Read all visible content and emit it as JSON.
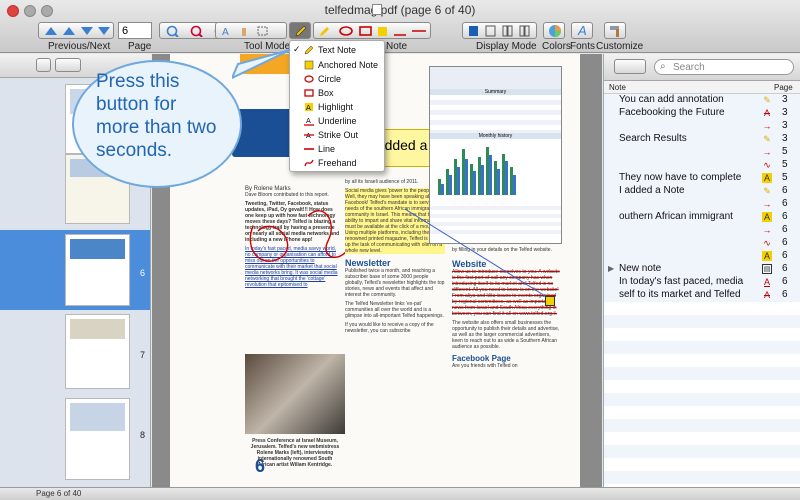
{
  "window": {
    "title": "telfedmag.pdf (page 6 of 40)"
  },
  "toolbar": {
    "page_number": "6",
    "labels": {
      "prev_next": "Previous/Next",
      "page": "Page",
      "tool_mode": "Tool Mode",
      "note": "Note",
      "display_mode": "Display Mode",
      "colors": "Colors",
      "fonts": "Fonts",
      "customize": "Customize"
    }
  },
  "callout": {
    "text": "Press this button for more than two seconds."
  },
  "tool_menu": {
    "items": [
      {
        "label": "Text Note",
        "checked": true,
        "icon": "text-note-icon"
      },
      {
        "label": "Anchored Note",
        "checked": false,
        "icon": "anchored-note-icon"
      },
      {
        "label": "Circle",
        "checked": false,
        "icon": "circle-icon"
      },
      {
        "label": "Box",
        "checked": false,
        "icon": "box-icon"
      },
      {
        "label": "Highlight",
        "checked": false,
        "icon": "highlight-icon"
      },
      {
        "label": "Underline",
        "checked": false,
        "icon": "underline-icon"
      },
      {
        "label": "Strike Out",
        "checked": false,
        "icon": "strike-out-icon"
      },
      {
        "label": "Line",
        "checked": false,
        "icon": "line-icon"
      },
      {
        "label": "Freehand",
        "checked": false,
        "icon": "freehand-icon"
      }
    ]
  },
  "thumbnails": [
    {
      "number": ""
    },
    {
      "number": ""
    },
    {
      "number": "6"
    },
    {
      "number": "7"
    },
    {
      "number": "8"
    }
  ],
  "page": {
    "note_box_text": "I added a Note",
    "byline": "By Rolene Marks",
    "byline2": "Dave Bloom contributed to this report.",
    "col1_lead": "Tweeting, Twitter, Facebook, status updates, iPad, Oy gevalt!!! How does one keep up with how fast technology moves these days? Telfed is blazing a technology trail by having a presence on nearly all social media networks and including a new iPhone app!",
    "col1_p2": "In today's fast paced, media savvy world, no company or organisation can afford to miss out on the opportunities to communicate with their market that social media networks bring. It was social media networking that brought the 'cottage' revolution that epitomised to",
    "col2_top": "by all its Israeli audience of 2011.",
    "col2_p1": "Social media gives 'power to the people'. Well, they may have been speaking about Facebook! Telfed's mandate is to service the needs of the southern African immigrant community in Israel. This means that the ability to impart and share vital information must be available at the click of a mouse. Using multiple platforms, including the renowned printed magazine, Telfed is taking up the task of communicating with olim on a whole new level.",
    "newsletter_head": "Newsletter",
    "col2_p2": "Published twice a month, and reaching a subscriber base of some 3000 people globally, Telfed's newsletter highlights the top stories, news and events that affect and interest the community.",
    "col2_p3": "The Telfed Newsletter links 'ex-pat' communities all over the world and is a glimpse into all-important Telfed happenings.",
    "col2_p4": "If you would like to receive a copy of the newsletter, you can subscribe",
    "col3_top": "by filling in your details on the Telfed website.",
    "website_head": "Website",
    "col3_p1": "Allow us to introduce ourselves to you. A website is the first port-of-call any company has when introducing itself to its market and Telfed is no different. All you need to know is on the website! From aliya and klita issues to events organised by regional committees, as well as important news from Israel and South Africa everything in between, you can find it all on www.telfed.org.il.",
    "col3_p2": "The website also offers small businesses the opportunity to publish their details and advertise, as well as the larger commercial advertisers, keen to reach out to as wide a Southern African audience as possible.",
    "facebook_head": "Facebook Page",
    "col3_p3": "Are you friends with Telfed on",
    "photo_caption": "Press Conference at Israel Museum, Jerusalem. Telfed's new webmistress Rolene Marks (left), interviewing internationally renowned South African artist Wiliam Kentridge.",
    "page_number": "6",
    "dash_title": "Summary",
    "dash_subtitle": "Monthly history"
  },
  "notes_panel": {
    "search_placeholder": "Search",
    "col_note": "Note",
    "col_page": "Page",
    "rows": [
      {
        "text": "You can add annotation",
        "page": "3",
        "icon": "pencil-icon",
        "color": "#d9b000"
      },
      {
        "text": "Facebooking the Future",
        "page": "3",
        "icon": "strike-icon",
        "color": "#c00000"
      },
      {
        "text": "",
        "page": "3",
        "icon": "arrow-icon",
        "color": "#c00000"
      },
      {
        "text": "Search Results",
        "page": "3",
        "icon": "pencil-icon",
        "color": "#d9b000"
      },
      {
        "text": "",
        "page": "5",
        "icon": "arrow-icon",
        "color": "#c00000"
      },
      {
        "text": "",
        "page": "5",
        "icon": "freehand-icon",
        "color": "#c00000"
      },
      {
        "text": "They now have to complete",
        "page": "5",
        "icon": "highlight-icon",
        "color": "#d9b000"
      },
      {
        "text": "I added a Note",
        "page": "6",
        "icon": "pencil-icon",
        "color": "#d9b000"
      },
      {
        "text": "",
        "page": "6",
        "icon": "arrow-icon",
        "color": "#c00000"
      },
      {
        "text": "outhern African immigrant",
        "page": "6",
        "icon": "highlight-icon",
        "color": "#d9b000"
      },
      {
        "text": "",
        "page": "6",
        "icon": "arrow-icon",
        "color": "#c00000"
      },
      {
        "text": "",
        "page": "6",
        "icon": "freehand-icon",
        "color": "#c00000"
      },
      {
        "text": "",
        "page": "6",
        "icon": "highlight-icon",
        "color": "#d9b000"
      },
      {
        "text": "New note",
        "page": "6",
        "icon": "note-icon",
        "color": "#333333",
        "expandable": true
      },
      {
        "text": "In today's fast paced, media",
        "page": "6",
        "icon": "underline-icon",
        "color": "#c00000"
      },
      {
        "text": "self to its market and Telfed",
        "page": "6",
        "icon": "strike-icon",
        "color": "#c00000"
      }
    ]
  },
  "status": {
    "text": "Page 6 of 40"
  }
}
